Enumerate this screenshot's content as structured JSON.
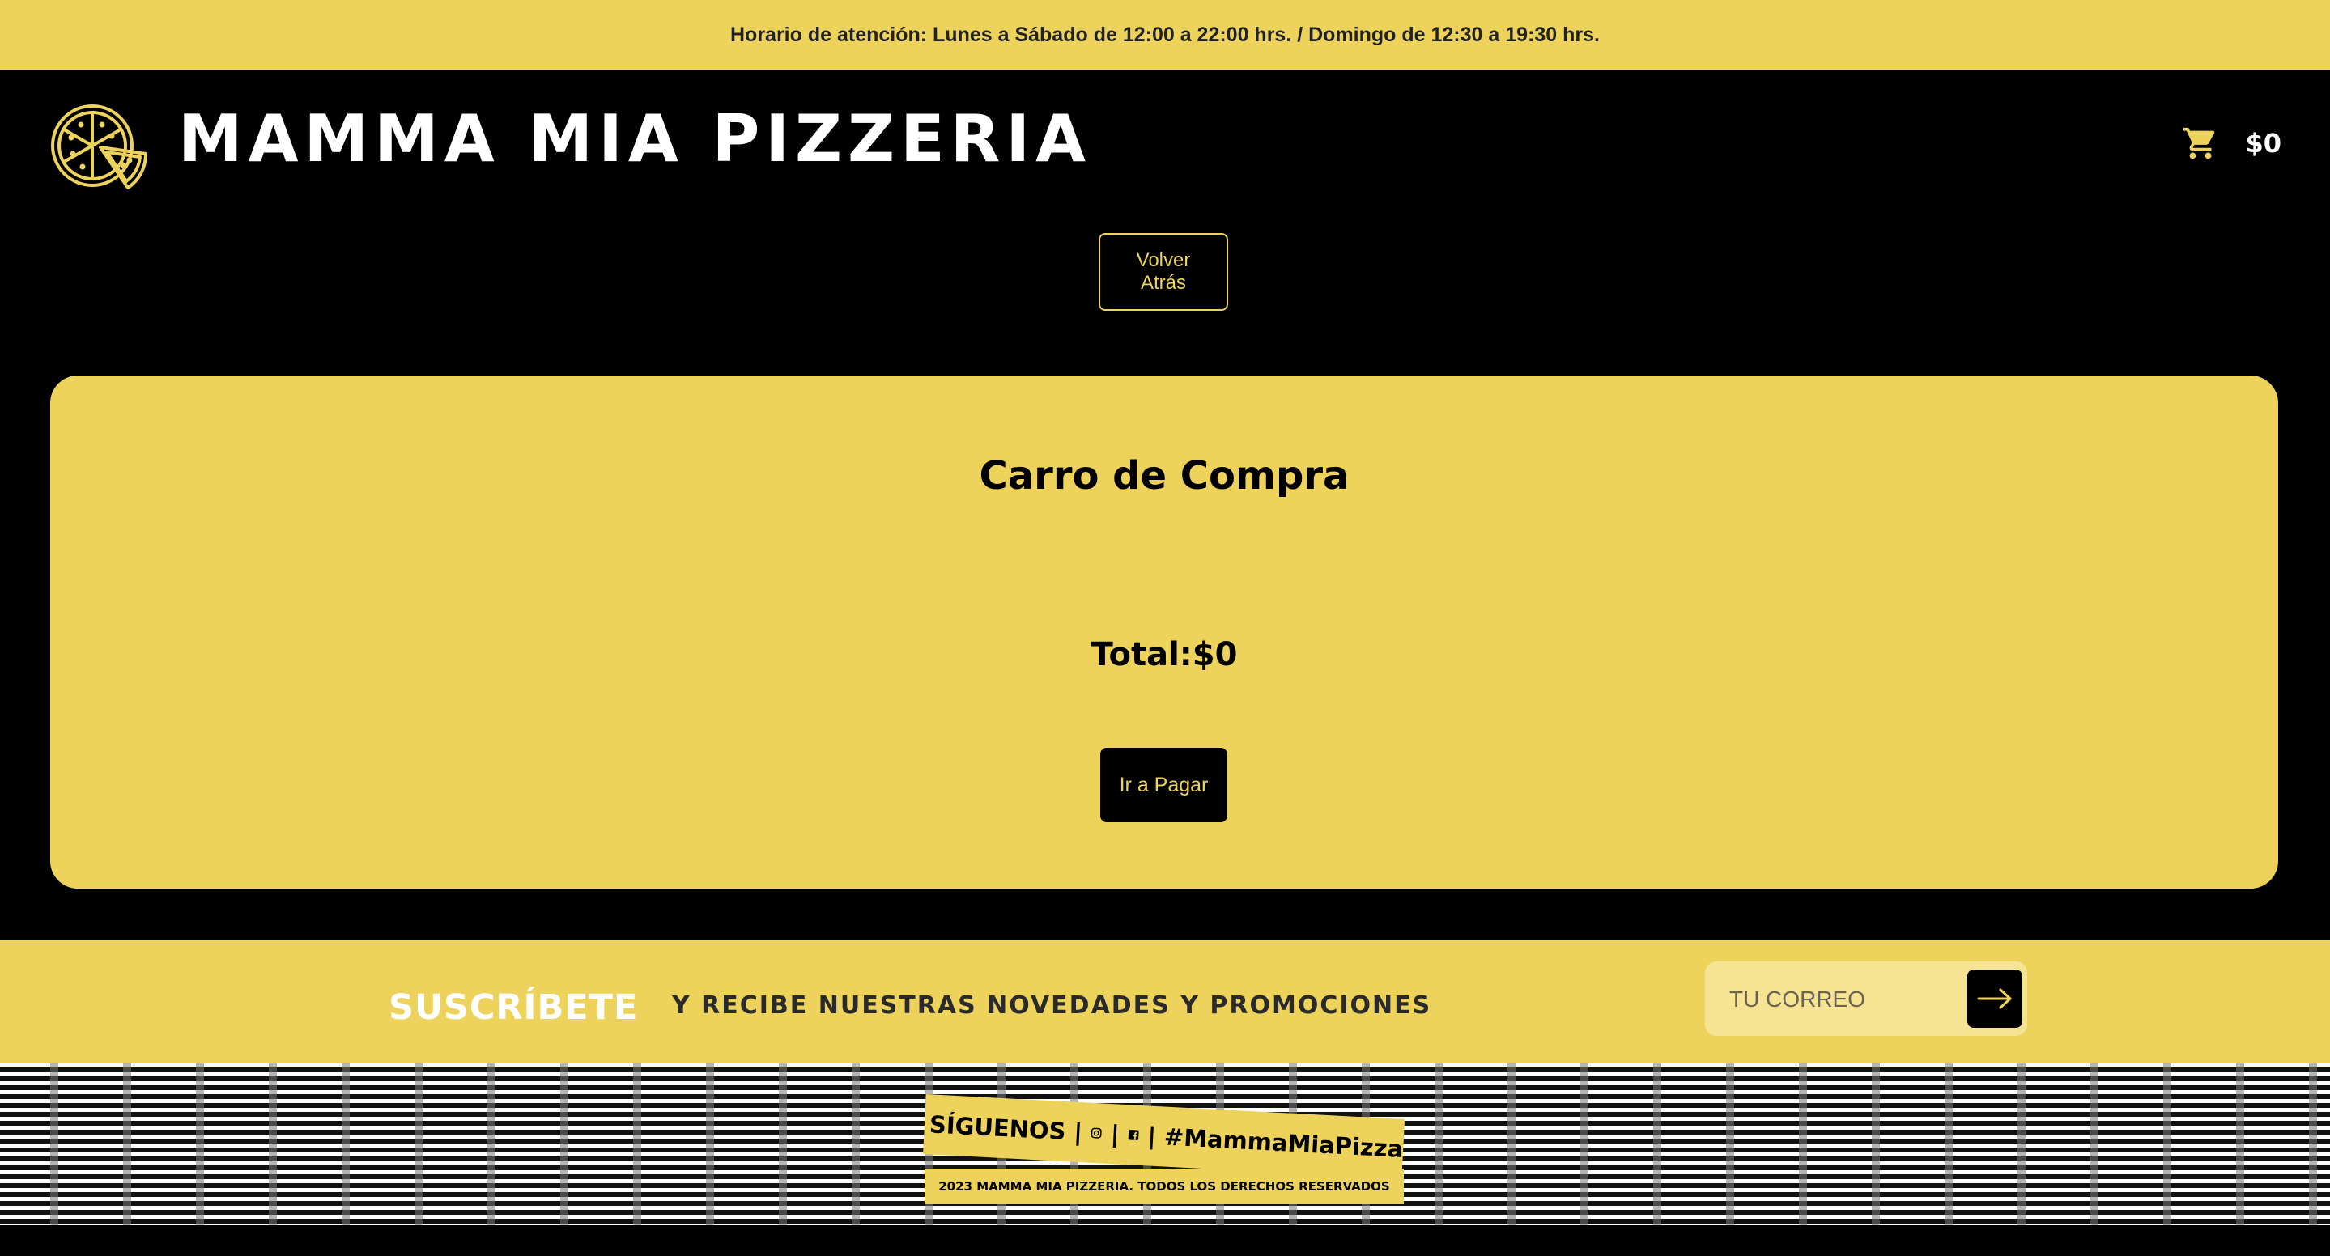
{
  "topbar": {
    "hours": "Horario de atención: Lunes a Sábado de 12:00 a 22:00 hrs. / Domingo de 12:30 a 19:30 hrs."
  },
  "header": {
    "brand": "MAMMA MIA PIZZERIA",
    "logo_icon": "pizza-icon",
    "cart_icon": "shopping-cart-icon",
    "cart_total": "$0"
  },
  "nav": {
    "back_label": "Volver Atrás"
  },
  "cart": {
    "title": "Carro de Compra",
    "total_label": "Total:$0",
    "pay_label": "Ir a Pagar"
  },
  "subscribe": {
    "title": "SUSCRÍBETE",
    "text": "Y RECIBE NUESTRAS NOVEDADES Y PROMOCIONES",
    "email_placeholder": "TU CORREO",
    "submit_icon": "arrow-right-icon"
  },
  "footer": {
    "follow_label": "SÍGUENOS",
    "separator": "|",
    "hashtag": "#MammaMiaPizza",
    "instagram_icon": "instagram-icon",
    "facebook_icon": "facebook-icon",
    "copyright": "2023 MAMMA MIA PIZZERIA. TODOS LOS DERECHOS RESERVADOS"
  },
  "colors": {
    "accent": "#edd35c",
    "background": "#000000",
    "input_bg": "#f7e394"
  }
}
